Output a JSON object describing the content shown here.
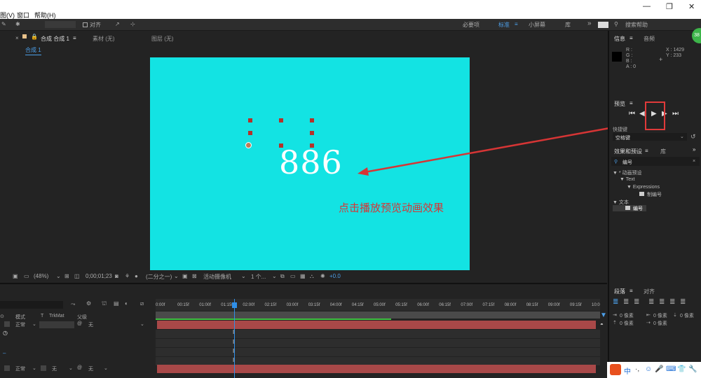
{
  "menubar": {
    "items": [
      "图(V)",
      "窗口",
      "帮助(H)"
    ],
    "window_controls": [
      "—",
      "❐",
      "✕"
    ]
  },
  "toolbar": {
    "snap_label": "对齐",
    "workspaces": [
      "必要项",
      "标准",
      "小屏幕",
      "库"
    ],
    "active_workspace": "标准",
    "overflow": "»",
    "search_placeholder": "搜索帮助"
  },
  "composition": {
    "tab_title": "合成 合成 1",
    "tab_footage": "素材 (无)",
    "tab_layer": "图层 (无)",
    "subtab": "合成 1",
    "text_layer_content": "886",
    "annotation": "点击播放预览动画效果",
    "canvas_color": "#13e3e3",
    "annotation_color": "#d63535"
  },
  "viewer_bar": {
    "zoom": "(48%)",
    "timecode": "0;00;01;23",
    "resolution": "(二分之一)",
    "camera": "活动摄像机",
    "views": "1 个...",
    "exposure": "+0.0"
  },
  "timeline": {
    "ruler_ticks": [
      "0:00f",
      "00:15f",
      "01:00f",
      "01:15f",
      "02:00f",
      "02:15f",
      "03:00f",
      "03:15f",
      "04:00f",
      "04:15f",
      "05:00f",
      "05:15f",
      "06:00f",
      "06:15f",
      "07:00f",
      "07:15f",
      "08:00f",
      "08:15f",
      "09:00f",
      "09:15f",
      "10:0"
    ],
    "columns": {
      "mode": "模式",
      "t": "T",
      "trkmat": "TrkMat",
      "parent": "父级"
    },
    "layers": [
      {
        "mode": "正常",
        "trkmat": "",
        "parent": "无"
      },
      {
        "mode": "正常",
        "trkmat": "无",
        "parent": "无"
      }
    ]
  },
  "info_panel": {
    "tab_info": "信息",
    "tab_audio": "音频",
    "r": "R :",
    "g": "G :",
    "b": "B :",
    "a": "A : 0",
    "x": "X : 1429",
    "y": "Y : 233"
  },
  "preview_panel": {
    "title": "预览",
    "shortcut_label": "快捷键",
    "shortcut_value": "空格键"
  },
  "effects_panel": {
    "tab_effects": "效果和预设",
    "tab_library": "库",
    "search_value": "编号",
    "tree": [
      "▼ * 动画预设",
      "▼ Text",
      "▼ Expressions",
      "制编号",
      "▼ 文本",
      "编号"
    ]
  },
  "paragraph_panel": {
    "tab_paragraph": "段落",
    "tab_align": "对齐",
    "indent_values": [
      "0 像素",
      "0 像素",
      "0 像素",
      "0 像素",
      "0 像素"
    ]
  },
  "badge": "38",
  "ime": {
    "items": [
      "中",
      "·,",
      "☺",
      "🎤",
      "⌨",
      "👕",
      "🔧"
    ]
  }
}
